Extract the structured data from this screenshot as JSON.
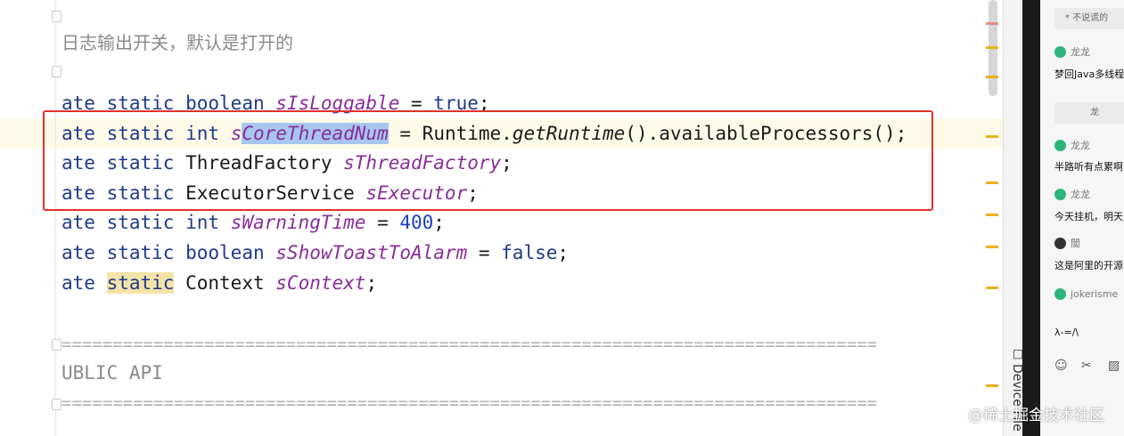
{
  "editor": {
    "comment": "日志输出开关，默认是打开的",
    "lines": [
      {
        "kw1": "ate",
        "kw2": "static",
        "type": "boolean",
        "field": "sIsLoggable",
        "op": " = ",
        "value": "true",
        "end": ";"
      },
      {
        "kw1": "ate",
        "kw2": "static",
        "type": "int",
        "field_prefix": "s",
        "field_selected": "CoreThreadNum",
        "op": " = ",
        "call_obj": "Runtime.",
        "call_method": "getRuntime",
        "call_rest": "().availableProcessors();"
      },
      {
        "kw1": "ate",
        "kw2": "static",
        "type": "ThreadFactory",
        "field": "sThreadFactory",
        "end": ";"
      },
      {
        "kw1": "ate",
        "kw2": "static",
        "type": "ExecutorService",
        "field": "sExecutor",
        "end": ";"
      },
      {
        "kw1": "ate",
        "kw2": "static",
        "type": "int",
        "field": "sWarningTime",
        "op": " = ",
        "value": "400",
        "end": ";"
      },
      {
        "kw1": "ate",
        "kw2": "static",
        "type": "boolean",
        "field": "sShowToastToAlarm",
        "op": " = ",
        "value": "false",
        "end": ";"
      },
      {
        "kw1": "ate",
        "kw2": "static",
        "type": "Context",
        "field": "sContext",
        "end": ";"
      }
    ],
    "separator": "================================================================================",
    "section_comment": "UBLIC API"
  },
  "side_tab": {
    "label": "Device File"
  },
  "chat": {
    "pill1": "* 不说谎的",
    "user1": "龙龙",
    "msg1": "梦回Java多线程",
    "pill2": "龙",
    "user2": "龙龙",
    "msg2": "半路听有点累啊",
    "user3": "龙龙",
    "msg3": "今天挂机，明天",
    "user4": "闇",
    "msg4": "这是阿里的开源",
    "user5": "jokerisme",
    "msg5": "λ-=/\\",
    "tools": {
      "emoji": "☺",
      "scissors": "✂",
      "image": "▨"
    }
  },
  "watermark": "@稀土掘金技术社区",
  "colors": {
    "highlight_box": "#e2322b",
    "selection": "#a7c6f0",
    "keyword": "#1f3a8a",
    "field": "#8a2d9a",
    "number": "#1740c8",
    "avatar": "#2db57a"
  }
}
